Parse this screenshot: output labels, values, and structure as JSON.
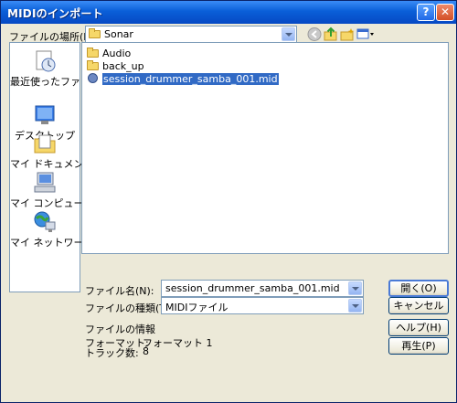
{
  "window": {
    "title": "MIDIのインポート"
  },
  "titlebar": {
    "help_glyph": "?",
    "close_glyph": "✕"
  },
  "location": {
    "label": "ファイルの場所(I):",
    "value": "Sonar"
  },
  "places": [
    {
      "label": "最近使ったファイル",
      "icon": "recent-documents-icon"
    },
    {
      "label": "デスクトップ",
      "icon": "desktop-icon"
    },
    {
      "label": "マイ ドキュメント",
      "icon": "my-documents-icon"
    },
    {
      "label": "マイ コンピュータ",
      "icon": "my-computer-icon"
    },
    {
      "label": "マイ ネットワーク",
      "icon": "my-network-icon"
    }
  ],
  "files": [
    {
      "name": "Audio",
      "type": "folder"
    },
    {
      "name": "back_up",
      "type": "folder"
    },
    {
      "name": "session_drummer_samba_001.mid",
      "type": "midi",
      "selected": true
    }
  ],
  "filename": {
    "label": "ファイル名(N):",
    "value": "session_drummer_samba_001.mid"
  },
  "filetype": {
    "label": "ファイルの種類(T):",
    "value": "MIDIファイル"
  },
  "info": {
    "heading": "ファイルの情報",
    "format_label": "フォーマット:",
    "format_value": "フォーマット 1",
    "tracks_label": "トラック数:",
    "tracks_value": "8"
  },
  "buttons": {
    "open": "開く(O)",
    "cancel": "キャンセル",
    "help": "ヘルプ(H)",
    "play": "再生(P)"
  },
  "colors": {
    "titlebar": "#0a5fd8",
    "selection": "#316ac5",
    "dialog_bg": "#ece9d8"
  }
}
